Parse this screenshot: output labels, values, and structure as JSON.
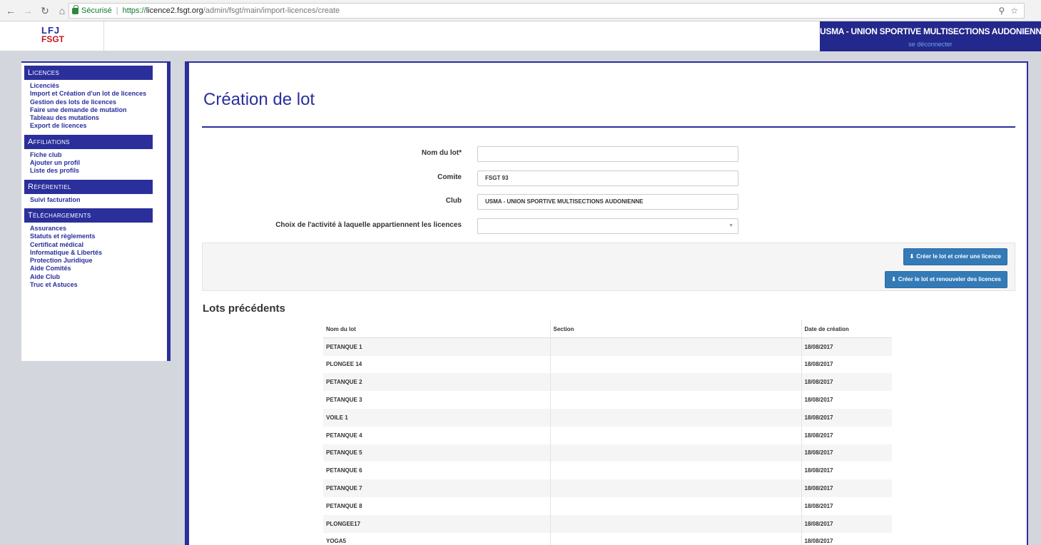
{
  "browser": {
    "secure_label": "Sécurisé",
    "url_scheme": "https://",
    "url_host": "licence2.fsgt.org",
    "url_path": "/admin/fsgt/main/import-licences/create"
  },
  "header": {
    "logo_top": "LFJ",
    "logo_bottom": "FSGT",
    "club_name": "USMA - UNION SPORTIVE MULTISECTIONS AUDONIENNE -",
    "logout": "se déconnecter"
  },
  "sidebar": {
    "sections": [
      {
        "title": "Licences",
        "items": [
          "Licenciés",
          "Import et Création d'un lot de licences",
          "Gestion des lots de licences",
          "Faire une demande de mutation",
          "Tableau des mutations",
          "Export de licences"
        ]
      },
      {
        "title": "Affiliations",
        "items": [
          "Fiche club",
          "Ajouter un profil",
          "Liste des profils"
        ]
      },
      {
        "title": "Référentiel",
        "items": [
          "Suivi facturation"
        ]
      },
      {
        "title": "Téléchargements",
        "items": [
          "Assurances",
          "Statuts et règlements",
          "Certificat médical",
          "Informatique & Libertés",
          "Protection Juridique",
          "Aide Comités",
          "Aide Club",
          "Truc et Astuces"
        ]
      }
    ]
  },
  "main": {
    "title": "Création de lot",
    "form": {
      "lot_name_label": "Nom du lot*",
      "lot_name_value": "",
      "comite_label": "Comite",
      "comite_value": "FSGT 93",
      "club_label": "Club",
      "club_value": "USMA - UNION SPORTIVE MULTISECTIONS AUDONIENNE",
      "activity_label": "Choix de l'activité à laquelle appartiennent les licences",
      "activity_value": ""
    },
    "buttons": {
      "create_and_licence": "Créer le lot et créer une licence",
      "create_and_renew": "Créer le lot et renouveler des licences"
    },
    "previous_title": "Lots précédents",
    "table": {
      "headers": [
        "Nom du lot",
        "Section",
        "Date de création"
      ],
      "rows": [
        [
          "PETANQUE 1",
          "",
          "18/08/2017"
        ],
        [
          "PLONGEE 14",
          "",
          "18/08/2017"
        ],
        [
          "PETANQUE 2",
          "",
          "18/08/2017"
        ],
        [
          "PETANQUE 3",
          "",
          "18/08/2017"
        ],
        [
          "VOILE 1",
          "",
          "18/08/2017"
        ],
        [
          "PETANQUE 4",
          "",
          "18/08/2017"
        ],
        [
          "PETANQUE 5",
          "",
          "18/08/2017"
        ],
        [
          "PETANQUE 6",
          "",
          "18/08/2017"
        ],
        [
          "PETANQUE 7",
          "",
          "18/08/2017"
        ],
        [
          "PETANQUE 8",
          "",
          "18/08/2017"
        ],
        [
          "PLONGEE17",
          "",
          "18/08/2017"
        ],
        [
          "YOGA5",
          "",
          "18/08/2017"
        ]
      ]
    }
  },
  "colors": {
    "brand": "#2a2f9c",
    "button": "#337ab7"
  }
}
